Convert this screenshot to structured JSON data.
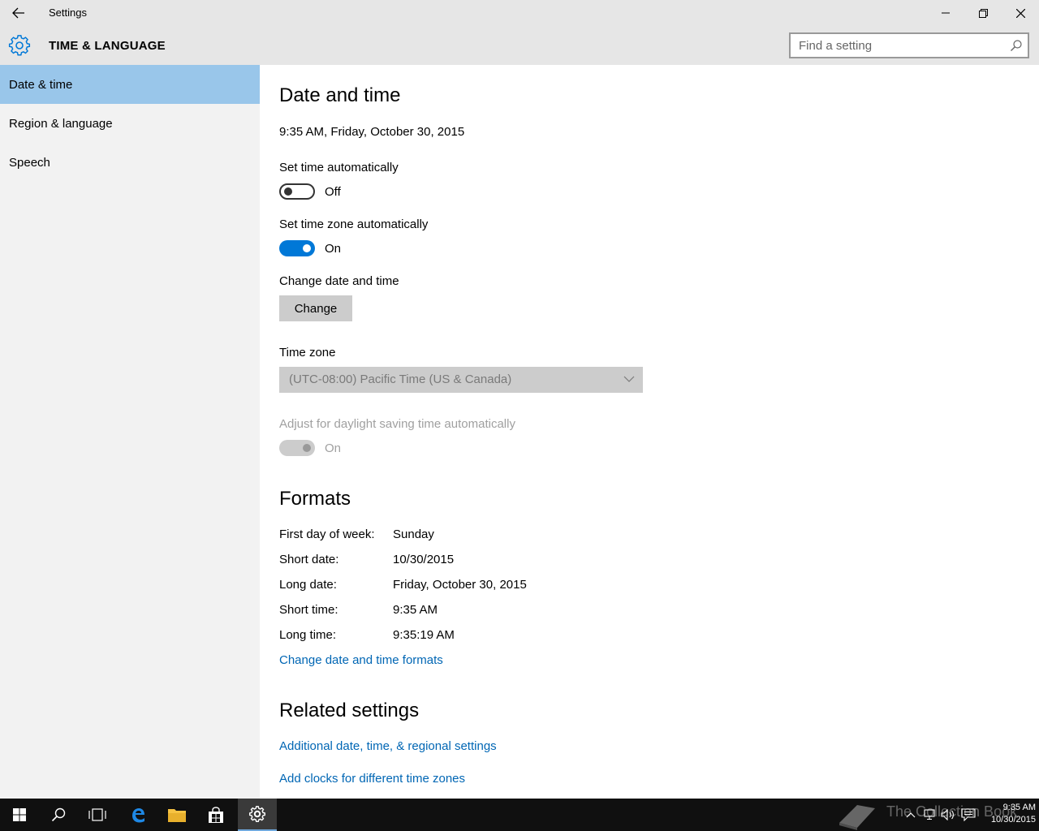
{
  "window": {
    "title": "Settings"
  },
  "header": {
    "section_title": "TIME & LANGUAGE",
    "search_placeholder": "Find a setting"
  },
  "sidebar": {
    "items": [
      {
        "label": "Date & time",
        "selected": true
      },
      {
        "label": "Region & language",
        "selected": false
      },
      {
        "label": "Speech",
        "selected": false
      }
    ]
  },
  "main": {
    "heading": "Date and time",
    "current_datetime": "9:35 AM, Friday, October 30, 2015",
    "set_time_auto": {
      "label": "Set time automatically",
      "state": "Off"
    },
    "set_tz_auto": {
      "label": "Set time zone automatically",
      "state": "On"
    },
    "change_datetime": {
      "label": "Change date and time",
      "button": "Change"
    },
    "time_zone": {
      "label": "Time zone",
      "value": "(UTC-08:00) Pacific Time (US & Canada)"
    },
    "dst": {
      "label": "Adjust for daylight saving time automatically",
      "state": "On"
    },
    "formats": {
      "heading": "Formats",
      "rows": [
        {
          "label": "First day of week:",
          "value": "Sunday"
        },
        {
          "label": "Short date:",
          "value": "10/30/2015"
        },
        {
          "label": "Long date:",
          "value": "Friday, October 30, 2015"
        },
        {
          "label": "Short time:",
          "value": "9:35 AM"
        },
        {
          "label": "Long time:",
          "value": "9:35:19 AM"
        }
      ],
      "link": "Change date and time formats"
    },
    "related": {
      "heading": "Related settings",
      "links": [
        "Additional date, time, & regional settings",
        "Add clocks for different time zones"
      ]
    }
  },
  "taskbar": {
    "clock_time": "9:35 AM",
    "clock_date": "10/30/2015",
    "watermark": "The Collection Book"
  },
  "colors": {
    "accent": "#0078d7",
    "link": "#0066b4",
    "selected_nav": "#99c6ea",
    "chrome": "#e6e6e6",
    "sidebar": "#f2f2f2",
    "taskbar": "#101010"
  }
}
